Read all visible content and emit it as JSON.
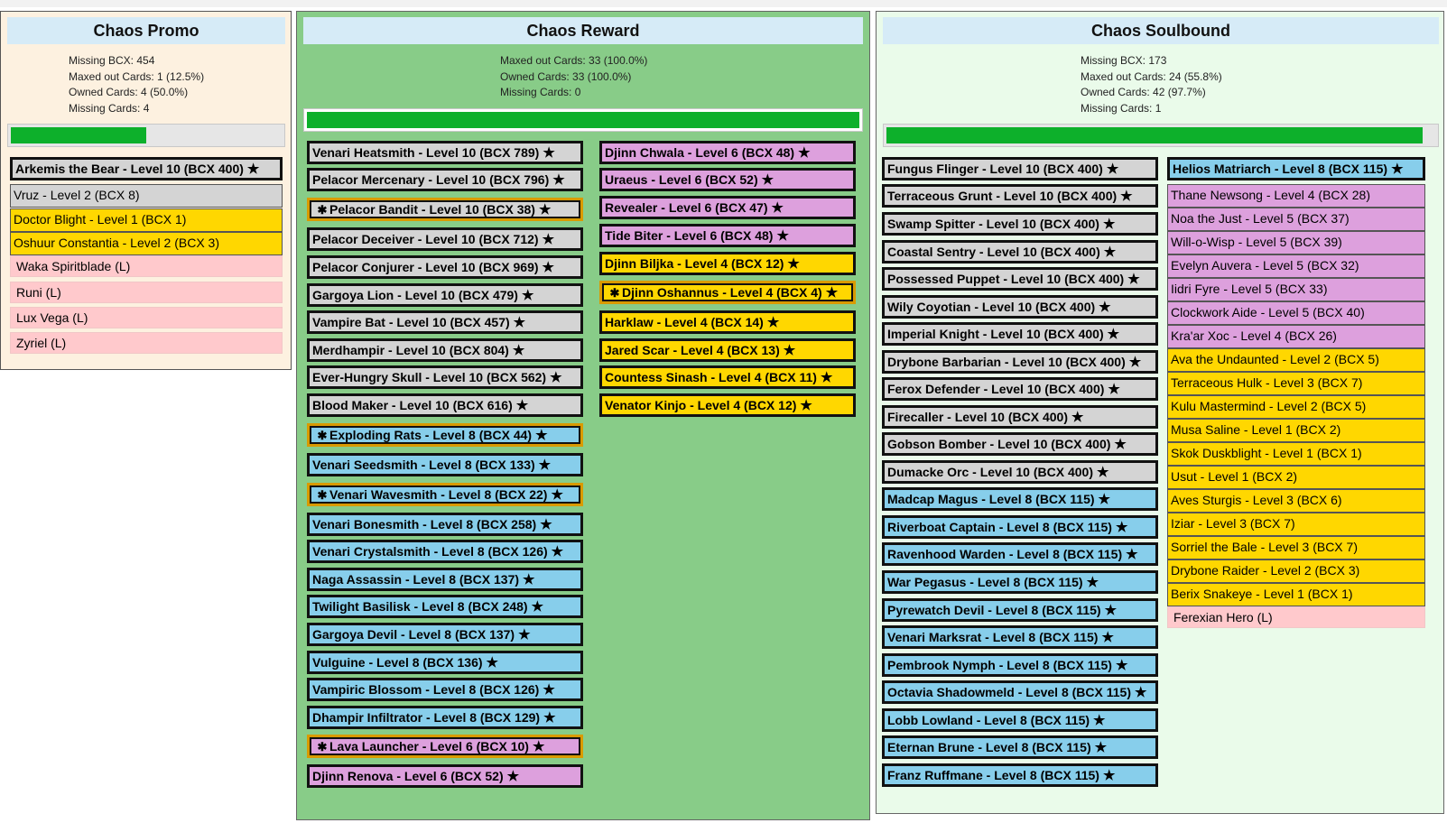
{
  "icons": {
    "star": "★",
    "sparkle": "✱"
  },
  "promo": {
    "title": "Chaos Promo",
    "stats": [
      "Missing BCX: 454",
      "Maxed out Cards: 1 (12.5%)",
      "Owned Cards: 4 (50.0%)",
      "Missing Cards: 4"
    ],
    "progress": 0.5,
    "cards": [
      {
        "label": "Arkemis the Bear - Level 10 (BCX 400)",
        "color": "gray",
        "bold": true,
        "star": true
      },
      {
        "label": "Vruz - Level 2 (BCX 8)",
        "color": "gray"
      },
      {
        "label": "Doctor Blight - Level 1 (BCX 1)",
        "color": "gold"
      },
      {
        "label": "Oshuur Constantia - Level 2 (BCX 3)",
        "color": "gold"
      },
      {
        "label": "Waka Spiritblade (L)",
        "color": "lpink"
      },
      {
        "label": "Runi (L)",
        "color": "lpink"
      },
      {
        "label": "Lux Vega (L)",
        "color": "lpink"
      },
      {
        "label": "Zyriel (L)",
        "color": "lpink"
      }
    ]
  },
  "reward": {
    "title": "Chaos Reward",
    "stats": [
      "Maxed out Cards: 33 (100.0%)",
      "Owned Cards: 33 (100.0%)",
      "Missing Cards: 0"
    ],
    "progress": 1.0,
    "col1": [
      {
        "label": "Venari Heatsmith - Level 10 (BCX 789)",
        "color": "gray",
        "star": true
      },
      {
        "label": "Pelacor Mercenary - Level 10 (BCX 796)",
        "color": "gray",
        "star": true
      },
      {
        "label": "Pelacor Bandit - Level 10 (BCX 38)",
        "color": "gray",
        "star": true,
        "gold": true
      },
      {
        "label": "Pelacor Deceiver - Level 10 (BCX 712)",
        "color": "gray",
        "star": true
      },
      {
        "label": "Pelacor Conjurer - Level 10 (BCX 969)",
        "color": "gray",
        "star": true
      },
      {
        "label": "Gargoya Lion - Level 10 (BCX 479)",
        "color": "gray",
        "star": true
      },
      {
        "label": "Vampire Bat - Level 10 (BCX 457)",
        "color": "gray",
        "star": true
      },
      {
        "label": "Merdhampir - Level 10 (BCX 804)",
        "color": "gray",
        "star": true
      },
      {
        "label": "Ever-Hungry Skull - Level 10 (BCX 562)",
        "color": "gray",
        "star": true
      },
      {
        "label": "Blood Maker - Level 10 (BCX 616)",
        "color": "gray",
        "star": true
      },
      {
        "label": "Exploding Rats - Level 8 (BCX 44)",
        "color": "blue",
        "star": true,
        "gold": true
      },
      {
        "label": "Venari Seedsmith - Level 8 (BCX 133)",
        "color": "blue",
        "star": true
      },
      {
        "label": "Venari Wavesmith - Level 8 (BCX 22)",
        "color": "blue",
        "star": true,
        "gold": true
      },
      {
        "label": "Venari Bonesmith - Level 8 (BCX 258)",
        "color": "blue",
        "star": true
      },
      {
        "label": "Venari Crystalsmith - Level 8 (BCX 126)",
        "color": "blue",
        "star": true
      },
      {
        "label": "Naga Assassin - Level 8 (BCX 137)",
        "color": "blue",
        "star": true
      },
      {
        "label": "Twilight Basilisk - Level 8 (BCX 248)",
        "color": "blue",
        "star": true
      },
      {
        "label": "Gargoya Devil - Level 8 (BCX 137)",
        "color": "blue",
        "star": true
      },
      {
        "label": "Vulguine - Level 8 (BCX 136)",
        "color": "blue",
        "star": true
      },
      {
        "label": "Vampiric Blossom - Level 8 (BCX 126)",
        "color": "blue",
        "star": true
      },
      {
        "label": "Dhampir Infiltrator - Level 8 (BCX 129)",
        "color": "blue",
        "star": true
      },
      {
        "label": "Lava Launcher - Level 6 (BCX 10)",
        "color": "pink",
        "star": true,
        "gold": true
      },
      {
        "label": "Djinn Renova - Level 6 (BCX 52)",
        "color": "pink",
        "star": true
      }
    ],
    "col2": [
      {
        "label": "Djinn Chwala - Level 6 (BCX 48)",
        "color": "pink",
        "star": true
      },
      {
        "label": "Uraeus - Level 6 (BCX 52)",
        "color": "pink",
        "star": true
      },
      {
        "label": "Revealer - Level 6 (BCX 47)",
        "color": "pink",
        "star": true
      },
      {
        "label": "Tide Biter - Level 6 (BCX 48)",
        "color": "pink",
        "star": true
      },
      {
        "label": "Djinn Biljka - Level 4 (BCX 12)",
        "color": "gold",
        "star": true
      },
      {
        "label": "Djinn Oshannus - Level 4 (BCX 4)",
        "color": "gold",
        "star": true,
        "gold": true
      },
      {
        "label": "Harklaw - Level 4 (BCX 14)",
        "color": "gold",
        "star": true
      },
      {
        "label": "Jared Scar - Level 4 (BCX 13)",
        "color": "gold",
        "star": true
      },
      {
        "label": "Countess Sinash - Level 4 (BCX 11)",
        "color": "gold",
        "star": true
      },
      {
        "label": "Venator Kinjo - Level 4 (BCX 12)",
        "color": "gold",
        "star": true
      }
    ]
  },
  "soul": {
    "title": "Chaos Soulbound",
    "stats": [
      "Missing BCX: 173",
      "Maxed out Cards: 24 (55.8%)",
      "Owned Cards: 42 (97.7%)",
      "Missing Cards: 1"
    ],
    "progress": 0.977,
    "col1": [
      {
        "label": "Fungus Flinger - Level 10 (BCX 400)",
        "color": "gray",
        "star": true
      },
      {
        "label": "Terraceous Grunt - Level 10 (BCX 400)",
        "color": "gray",
        "star": true
      },
      {
        "label": "Swamp Spitter - Level 10 (BCX 400)",
        "color": "gray",
        "star": true
      },
      {
        "label": "Coastal Sentry - Level 10 (BCX 400)",
        "color": "gray",
        "star": true
      },
      {
        "label": "Possessed Puppet - Level 10 (BCX 400)",
        "color": "gray",
        "star": true
      },
      {
        "label": "Wily Coyotian - Level 10 (BCX 400)",
        "color": "gray",
        "star": true
      },
      {
        "label": "Imperial Knight - Level 10 (BCX 400)",
        "color": "gray",
        "star": true
      },
      {
        "label": "Drybone Barbarian - Level 10 (BCX 400)",
        "color": "gray",
        "star": true
      },
      {
        "label": "Ferox Defender - Level 10 (BCX 400)",
        "color": "gray",
        "star": true
      },
      {
        "label": "Firecaller - Level 10 (BCX 400)",
        "color": "gray",
        "star": true
      },
      {
        "label": "Gobson Bomber - Level 10 (BCX 400)",
        "color": "gray",
        "star": true
      },
      {
        "label": "Dumacke Orc - Level 10 (BCX 400)",
        "color": "gray",
        "star": true
      },
      {
        "label": "Madcap Magus - Level 8 (BCX 115)",
        "color": "blue",
        "star": true
      },
      {
        "label": "Riverboat Captain - Level 8 (BCX 115)",
        "color": "blue",
        "star": true
      },
      {
        "label": "Ravenhood Warden - Level 8 (BCX 115)",
        "color": "blue",
        "star": true
      },
      {
        "label": "War Pegasus - Level 8 (BCX 115)",
        "color": "blue",
        "star": true
      },
      {
        "label": "Pyrewatch Devil - Level 8 (BCX 115)",
        "color": "blue",
        "star": true
      },
      {
        "label": "Venari Marksrat - Level 8 (BCX 115)",
        "color": "blue",
        "star": true
      },
      {
        "label": "Pembrook Nymph - Level 8 (BCX 115)",
        "color": "blue",
        "star": true
      },
      {
        "label": "Octavia Shadowmeld - Level 8 (BCX 115)",
        "color": "blue",
        "star": true
      },
      {
        "label": "Lobb Lowland - Level 8 (BCX 115)",
        "color": "blue",
        "star": true
      },
      {
        "label": "Eternan Brune - Level 8 (BCX 115)",
        "color": "blue",
        "star": true
      },
      {
        "label": "Franz Ruffmane - Level 8 (BCX 115)",
        "color": "blue",
        "star": true
      }
    ],
    "col2": [
      {
        "label": "Helios Matriarch - Level 8 (BCX 115)",
        "color": "blue",
        "star": true,
        "bold": true
      },
      {
        "label": "Thane Newsong - Level 4 (BCX 28)",
        "color": "pink"
      },
      {
        "label": "Noa the Just - Level 5 (BCX 37)",
        "color": "pink"
      },
      {
        "label": "Will-o-Wisp - Level 5 (BCX 39)",
        "color": "pink"
      },
      {
        "label": "Evelyn Auvera - Level 5 (BCX 32)",
        "color": "pink"
      },
      {
        "label": "Iidri Fyre - Level 5 (BCX 33)",
        "color": "pink"
      },
      {
        "label": "Clockwork Aide - Level 5 (BCX 40)",
        "color": "pink"
      },
      {
        "label": "Kra'ar Xoc - Level 4 (BCX 26)",
        "color": "pink"
      },
      {
        "label": "Ava the Undaunted - Level 2 (BCX 5)",
        "color": "gold"
      },
      {
        "label": "Terraceous Hulk - Level 3 (BCX 7)",
        "color": "gold"
      },
      {
        "label": "Kulu Mastermind - Level 2 (BCX 5)",
        "color": "gold"
      },
      {
        "label": "Musa Saline - Level 1 (BCX 2)",
        "color": "gold"
      },
      {
        "label": "Skok Duskblight - Level 1 (BCX 1)",
        "color": "gold"
      },
      {
        "label": "Usut - Level 1 (BCX 2)",
        "color": "gold"
      },
      {
        "label": "Aves Sturgis - Level 3 (BCX 6)",
        "color": "gold"
      },
      {
        "label": "Iziar - Level 3 (BCX 7)",
        "color": "gold"
      },
      {
        "label": "Sorriel the Bale - Level 3 (BCX 7)",
        "color": "gold"
      },
      {
        "label": "Drybone Raider - Level 2 (BCX 3)",
        "color": "gold"
      },
      {
        "label": "Berix Snakeye - Level 1 (BCX 1)",
        "color": "gold"
      },
      {
        "label": "Ferexian Hero (L)",
        "color": "lpink"
      }
    ]
  }
}
